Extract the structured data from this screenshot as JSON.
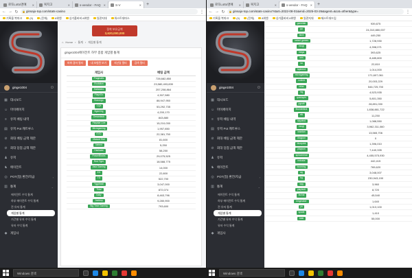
{
  "browser": {
    "left_tabs": [
      "로또Lotto명예",
      "복지고",
      "s-vendor - FAQ",
      "S-V"
    ],
    "right_tabs": [
      "로또Lotto명예",
      "복지고",
      "s-vendor - FAQ"
    ],
    "left_url": "ginsajo-top.com/stats-casino",
    "right_url": "ginsajo-top.com/stats-casino?start=2022-08-01&end=2025-03-26&agent=&cat=other&type=",
    "bookmarks": [
      "기록을 북마크",
      "(9)",
      "(전체)",
      "8위엔",
      "싱가폴비비 8위엔",
      "일관지대",
      "워스트대마스",
      "제스트대드임"
    ],
    "new_tab": "+"
  },
  "sidebar": {
    "username": "ginge1004",
    "items": [
      {
        "label": "대시보드",
        "icon": "dashboard-icon"
      },
      {
        "label": "마이페이지",
        "icon": "user-icon"
      },
      {
        "label": "유저 베팅 내역",
        "icon": "list-icon"
      },
      {
        "label": "유저 Pot 캐트루스",
        "icon": "doc-icon"
      },
      {
        "label": "회대 베팅 금액 제한",
        "icon": "limit-icon"
      },
      {
        "label": "회대 당첨 금액 제한",
        "icon": "limit-icon"
      },
      {
        "label": "유저",
        "icon": "users-icon"
      },
      {
        "label": "에이전트",
        "icon": "agent-icon"
      },
      {
        "label": "POT(정) 환전/지급",
        "icon": "coin-icon"
      },
      {
        "label": "통계",
        "icon": "chart-icon"
      }
    ],
    "sub_items": [
      "에이전트 수익 통계",
      "하부 에이전트 수익 통계",
      "전 유저 통계",
      "게임별 통계",
      "기간별 유저 수익 통계",
      "유저 수익 통계"
    ],
    "active_sub": "게임별 통계",
    "last_item": {
      "label": "게임사",
      "icon": "game-icon"
    }
  },
  "main": {
    "balance_label": "정착 보유금액",
    "balance_value": "3,620,000,000",
    "breadcrumb": [
      "Home",
      "통계",
      "게임별 통계"
    ],
    "panel_title": "ginge1004에이전트 하부 종합 게임별 통계",
    "buttons": [
      "파워 경마 필터",
      "내 보험된 보기",
      "지난달 필터",
      "검색 필터"
    ],
    "col_game": "게임사",
    "col_amount": "베팅 금액",
    "rows": [
      {
        "game": "Pragmatic",
        "amount": "728,682,850"
      },
      {
        "game": "Evolution",
        "amount": "23,580,493,839"
      },
      {
        "game": "Habanero",
        "amount": "257,208,864"
      },
      {
        "game": "PlaynGo",
        "amount": "4,307,580"
      },
      {
        "game": "Booongo",
        "amount": "88,947,950"
      },
      {
        "game": "CQ9",
        "amount": "53,292,735"
      },
      {
        "game": "Bgaming",
        "amount": "4,200,170"
      },
      {
        "game": "Dreamtech",
        "amount": "843,880"
      },
      {
        "game": "Playstar Live",
        "amount": "15,210,030"
      },
      {
        "game": "Microgaming",
        "amount": "1,957,850"
      },
      {
        "game": "EVO",
        "amount": "22,381,750"
      },
      {
        "game": "Mascot Slot",
        "amount": "81,600"
      },
      {
        "game": "Netent",
        "amount": "5,250"
      },
      {
        "game": "Hacksaw",
        "amount": "58,250"
      },
      {
        "game": "PowerBlocks",
        "amount": "29,075,525"
      },
      {
        "game": "Red Tiger",
        "amount": "18,588,775"
      },
      {
        "game": "Asia Gaming",
        "amount": "14,000"
      },
      {
        "game": "EG",
        "amount": "22,800"
      },
      {
        "game": "TG",
        "amount": "522,700"
      },
      {
        "game": "Yggdrasil",
        "amount": "3,047,000"
      },
      {
        "game": "Tidal",
        "amount": "872,074"
      },
      {
        "game": "Bally",
        "amount": "8,463,796"
      },
      {
        "game": "Jacktop",
        "amount": "9,280,900"
      },
      {
        "game": "Big Time Gaming",
        "amount": "793,600"
      }
    ]
  },
  "right": {
    "rows": [
      {
        "game": "gamelab",
        "amount": "939,875"
      },
      {
        "game": "pp",
        "amount": "24,310,880,007"
      },
      {
        "game": "aura",
        "amount": "449,250"
      },
      {
        "game": "netent games",
        "amount": "1,728,930"
      },
      {
        "game": "ezugi",
        "amount": "4,398,071"
      },
      {
        "game": "mega",
        "amount": "393,625"
      },
      {
        "game": "wm",
        "amount": "8,485,800"
      },
      {
        "game": "sa",
        "amount": "22,810"
      },
      {
        "game": "toptrend",
        "amount": "1,014,000"
      },
      {
        "game": "microgaming",
        "amount": "171,607,061"
      },
      {
        "game": "nolimit",
        "amount": "20,003,229"
      },
      {
        "game": "relax",
        "amount": "546,725,700"
      },
      {
        "game": "mg",
        "amount": "4,523,935"
      },
      {
        "game": "quickspin",
        "amount": "5,801,350"
      },
      {
        "game": "pgsoft",
        "amount": "28,891,030"
      },
      {
        "game": "thunderkick",
        "amount": "1,838,881,722"
      },
      {
        "game": "elk",
        "amount": "11,250"
      },
      {
        "game": "skywind",
        "amount": "1,088,550"
      },
      {
        "game": "ezugi",
        "amount": "3,962,311,060"
      },
      {
        "game": "wazdan",
        "amount": "13,565,706"
      },
      {
        "game": "dragoon",
        "amount": "0"
      },
      {
        "game": "blueprint",
        "amount": "1,396,010"
      },
      {
        "game": "playson",
        "amount": "7,440,335"
      },
      {
        "game": "spinomenal",
        "amount": "4,455,575,930"
      },
      {
        "game": "redrake",
        "amount": "442,415"
      },
      {
        "game": "booming",
        "amount": "765,620"
      },
      {
        "game": "ag",
        "amount": "3,048,007"
      },
      {
        "game": "bg",
        "amount": "230,943,190"
      },
      {
        "game": "xpg",
        "amount": "3,960"
      },
      {
        "game": "playtech",
        "amount": "8,720"
      },
      {
        "game": "fachai",
        "amount": "45,540"
      },
      {
        "game": "kingmaker",
        "amount": "1,640"
      },
      {
        "game": "jili",
        "amount": "1,013,100"
      },
      {
        "game": "spade",
        "amount": "1,410"
      },
      {
        "game": "total",
        "amount": "55,000"
      }
    ]
  },
  "taskbar": {
    "search_placeholder": "Windows 검색"
  }
}
